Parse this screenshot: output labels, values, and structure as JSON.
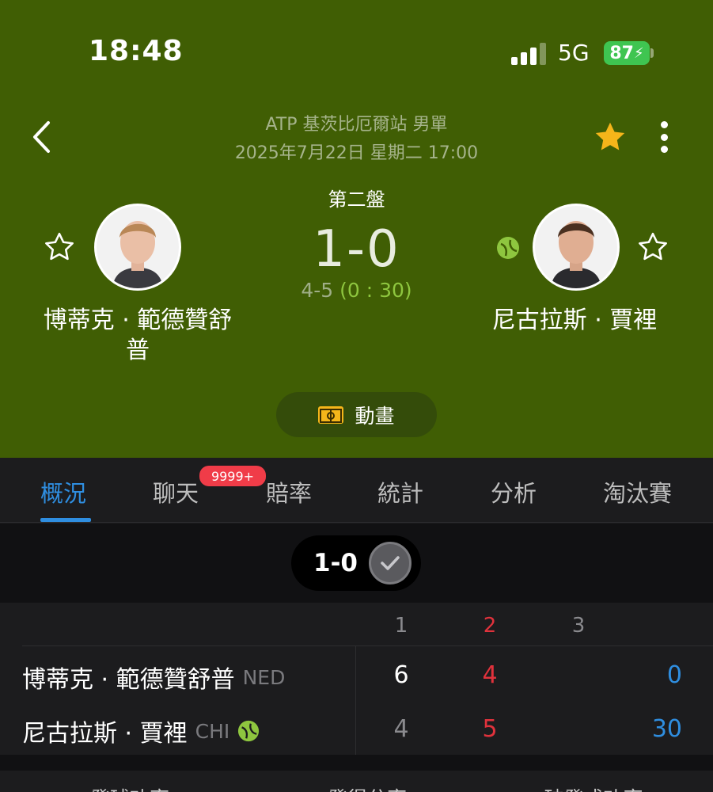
{
  "status_bar": {
    "time": "18:48",
    "network": "5G",
    "battery": "87"
  },
  "header": {
    "tournament": "ATP 基茨比厄爾站 男單",
    "datetime": "2025年7月22日 星期二 17:00",
    "set_label": "第二盤",
    "score": "1-0",
    "game_score_games": "4-5",
    "game_score_points": "(0 : 30)",
    "animation_label": "動畫"
  },
  "players": {
    "home": {
      "name_line1": "博蒂克 · 範德贊舒",
      "name_line2": "普"
    },
    "away": {
      "name_line1": "尼古拉斯 · 賈裡"
    }
  },
  "tabs": [
    "概況",
    "聊天",
    "賠率",
    "統計",
    "分析",
    "淘汰賽"
  ],
  "chat_badge": "9999+",
  "set_selector": {
    "label": "1-0"
  },
  "scoreboard": {
    "set_numbers": [
      "1",
      "2",
      "3"
    ],
    "rows": [
      {
        "name": "博蒂克 · 範德贊舒普",
        "country": "NED",
        "sets": [
          "6",
          "4"
        ],
        "points": "0"
      },
      {
        "name": "尼古拉斯 · 賈裡",
        "country": "CHI",
        "sets": [
          "4",
          "5"
        ],
        "points": "30"
      }
    ]
  },
  "stats_labels": [
    "發球功率",
    "發得分率",
    "破發成功率"
  ],
  "colors": {
    "header_green": "#405e04",
    "accent_blue": "#2f8ee0",
    "current_red": "#e0323c",
    "serve_green": "#8ec63f",
    "star_gold": "#f5b51a"
  }
}
